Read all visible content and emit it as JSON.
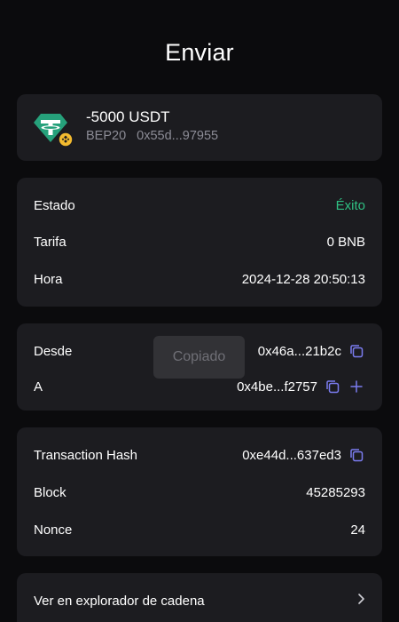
{
  "header": {
    "title": "Enviar"
  },
  "token": {
    "amount": "-5000 USDT",
    "network": "BEP20",
    "contract": "0x55d...97955",
    "logo_icon": "tether-usdt-icon",
    "badge_icon": "bnb-chain-badge-icon"
  },
  "status_card": {
    "rows": [
      {
        "label": "Estado",
        "value": "Éxito"
      },
      {
        "label": "Tarifa",
        "value": "0 BNB"
      },
      {
        "label": "Hora",
        "value": "2024-12-28 20:50:13"
      }
    ]
  },
  "address_card": {
    "from_label": "Desde",
    "from_value": "0x46a...21b2c",
    "to_label": "A",
    "to_value": "0x4be...f2757"
  },
  "hash_card": {
    "rows": [
      {
        "label": "Transaction Hash",
        "value": "0xe44d...637ed3"
      },
      {
        "label": "Block",
        "value": "45285293"
      },
      {
        "label": "Nonce",
        "value": "24"
      }
    ]
  },
  "explorer": {
    "label": "Ver en explorador de cadena"
  },
  "toast": {
    "text": "Copiado"
  },
  "colors": {
    "background": "#0b0b0d",
    "card": "#1c1c20",
    "success": "#2fc083",
    "accent_icon": "#7b7cf0",
    "tether_green": "#26a17b",
    "bnb_yellow": "#f3ba2f",
    "muted_text": "#8c8c96"
  }
}
